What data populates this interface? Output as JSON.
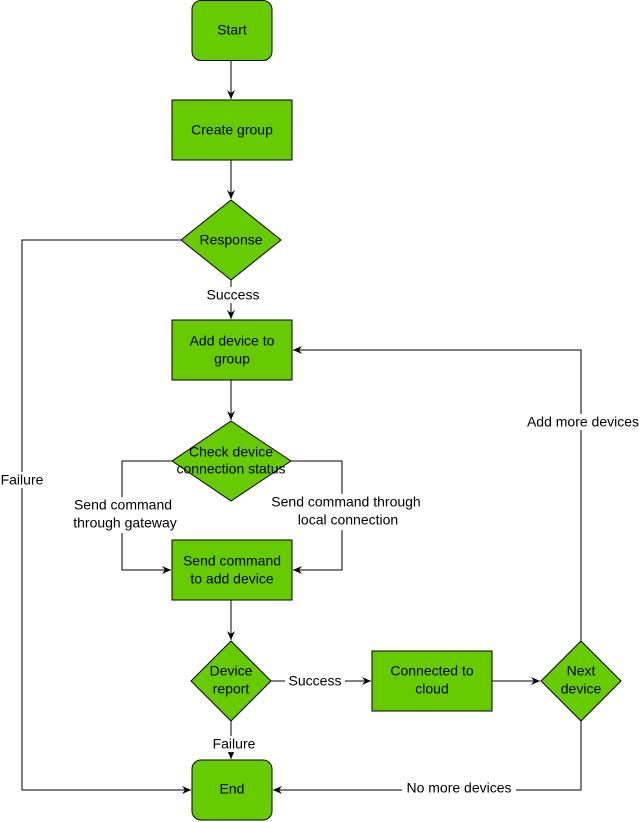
{
  "colors": {
    "node_fill": "#66CC00",
    "stroke": "#000000"
  },
  "nodes": {
    "start": "Start",
    "create_group": "Create group",
    "response": "Response",
    "add_device": [
      "Add device to",
      "group"
    ],
    "check_status": [
      "Check device",
      "connection status"
    ],
    "send_command": [
      "Send command",
      "to add device"
    ],
    "device_report": [
      "Device",
      "report"
    ],
    "connected": [
      "Connected to",
      "cloud"
    ],
    "next_device": [
      "Next",
      "device"
    ],
    "end": "End"
  },
  "edges": {
    "response_success": "Success",
    "response_failure": "Failure",
    "via_gateway": [
      "Send command",
      "through gateway"
    ],
    "via_local": [
      "Send command through",
      "local connection"
    ],
    "report_success": "Success",
    "report_failure": "Failure",
    "add_more": "Add more devices",
    "no_more": "No more devices"
  }
}
